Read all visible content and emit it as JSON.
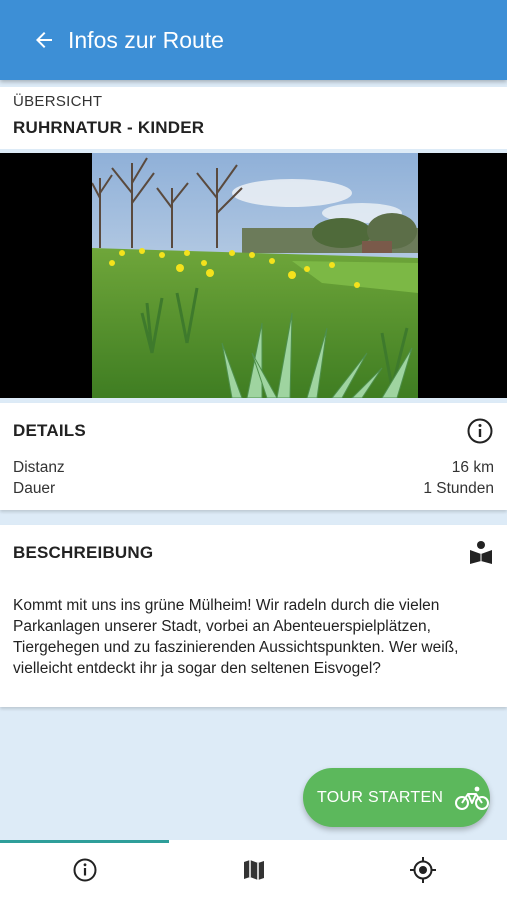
{
  "appbar": {
    "title": "Infos zur Route",
    "back_icon": "arrow-left-icon"
  },
  "overview": {
    "label": "ÜBERSICHT",
    "title": "RUHRNATUR - KINDER"
  },
  "image": {
    "description_icon": "route-photo"
  },
  "details": {
    "title": "DETAILS",
    "info_icon": "info-icon",
    "rows": [
      {
        "label": "Distanz",
        "value": "16 km"
      },
      {
        "label": "Dauer",
        "value": "1 Stunden"
      }
    ]
  },
  "description": {
    "title": "BESCHREIBUNG",
    "icon": "book-reader-icon",
    "text": "Kommt mit uns ins grüne Mülheim! Wir radeln durch die vielen Parkanlagen unserer Stadt, vorbei an Abenteuerspielplätzen, Tiergehegen und zu faszinierenden Aussichtspunkten. Wer weiß, vielleicht entdeckt ihr ja sogar den seltenen Eisvogel?"
  },
  "fab": {
    "label": "TOUR STARTEN",
    "icon": "bicycle-icon",
    "color": "#5cb85c"
  },
  "bottom_nav": [
    {
      "icon": "info-icon",
      "active": true
    },
    {
      "icon": "map-icon",
      "active": false
    },
    {
      "icon": "location-target-icon",
      "active": false
    }
  ],
  "colors": {
    "appbar": "#3d8fd6",
    "background": "#ddebf7",
    "active_tab": "#2e9e9a"
  }
}
